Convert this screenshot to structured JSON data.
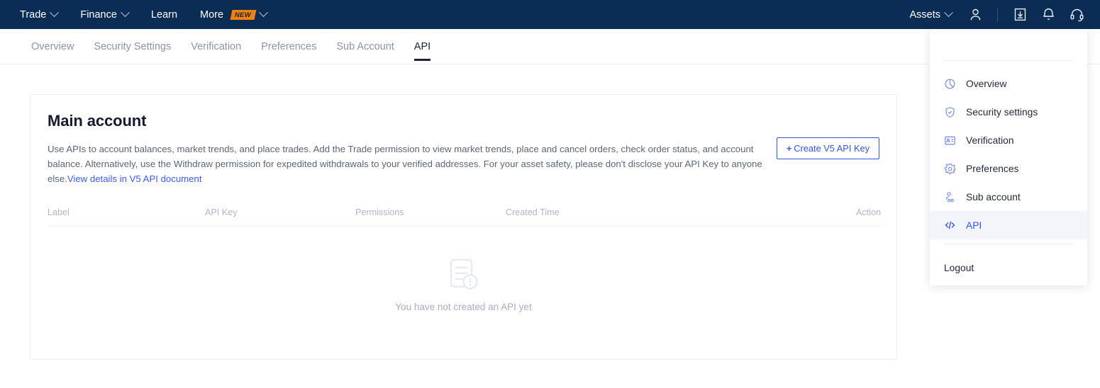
{
  "navbar": {
    "left_items": [
      {
        "label": "Trade",
        "has_caret": true,
        "badge": null
      },
      {
        "label": "Finance",
        "has_caret": true,
        "badge": null
      },
      {
        "label": "Learn",
        "has_caret": false,
        "badge": null
      },
      {
        "label": "More",
        "has_caret": true,
        "badge": "NEW"
      }
    ],
    "assets_label": "Assets",
    "icons": [
      "user-icon",
      "download-icon",
      "bell-icon",
      "headset-icon"
    ],
    "background": "#0b2c54",
    "badge_color": "#f2800c"
  },
  "subnav": {
    "items": [
      {
        "label": "Overview",
        "active": false
      },
      {
        "label": "Security Settings",
        "active": false
      },
      {
        "label": "Verification",
        "active": false
      },
      {
        "label": "Preferences",
        "active": false
      },
      {
        "label": "Sub Account",
        "active": false
      },
      {
        "label": "API",
        "active": true
      }
    ]
  },
  "card": {
    "title": "Main account",
    "description_part1": "Use APIs to account balances, market trends, and place trades. Add the Trade permission to view market trends, place and cancel orders, check order status, and account balance. Alternatively, use the Withdraw permission for expedited withdrawals to your verified addresses. For your asset safety, please don't disclose your API Key to anyone else.",
    "description_link": "View details in V5 API document",
    "create_button": "Create V5 API Key",
    "create_button_plus": "+",
    "table_headers": [
      "Label",
      "API Key",
      "Permissions",
      "Created Time",
      "Action"
    ],
    "table_rows": [],
    "empty_state_text": "You have not created an API yet",
    "accent_color": "#3355e8"
  },
  "account_dropdown": {
    "items": [
      {
        "label": "Overview",
        "icon": "pie-chart-icon",
        "active": false
      },
      {
        "label": "Security settings",
        "icon": "shield-check-icon",
        "active": false
      },
      {
        "label": "Verification",
        "icon": "id-card-icon",
        "active": false
      },
      {
        "label": "Preferences",
        "icon": "gear-icon",
        "active": false
      },
      {
        "label": "Sub account",
        "icon": "sub-account-icon",
        "active": false
      },
      {
        "label": "API",
        "icon": "code-icon",
        "active": true
      }
    ],
    "logout_label": "Logout",
    "active_color": "#3355e8",
    "active_background": "#f3f5fa"
  }
}
